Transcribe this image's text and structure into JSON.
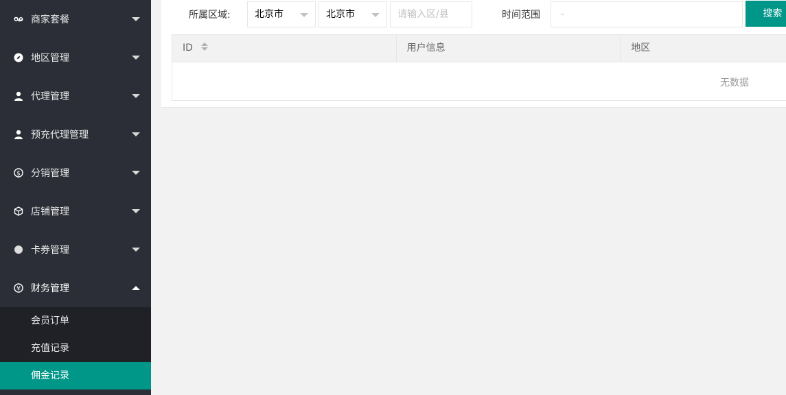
{
  "sidebar": {
    "items": [
      {
        "label": "商家套餐",
        "icon": "link-icon"
      },
      {
        "label": "地区管理",
        "icon": "compass-icon"
      },
      {
        "label": "代理管理",
        "icon": "user-icon"
      },
      {
        "label": "预充代理管理",
        "icon": "user-icon"
      },
      {
        "label": "分销管理",
        "icon": "dollar-icon"
      },
      {
        "label": "店铺管理",
        "icon": "cube-icon"
      },
      {
        "label": "卡券管理",
        "icon": "circle-icon"
      },
      {
        "label": "财务管理",
        "icon": "yen-icon"
      }
    ],
    "subitems": [
      {
        "label": "会员订单"
      },
      {
        "label": "充值记录"
      },
      {
        "label": "佣金记录"
      }
    ]
  },
  "filter": {
    "region_label": "所属区域:",
    "province_value": "北京市",
    "city_value": "北京市",
    "district_placeholder": "请输入区/县",
    "time_label": "时间范围",
    "time_placeholder": "-",
    "search_label": "搜索"
  },
  "table": {
    "headers": [
      "ID",
      "用户信息",
      "地区"
    ],
    "empty_text": "无数据"
  },
  "colors": {
    "accent": "#009688",
    "sidebar_bg": "#2b2e36",
    "subnav_bg": "#1f2127"
  }
}
